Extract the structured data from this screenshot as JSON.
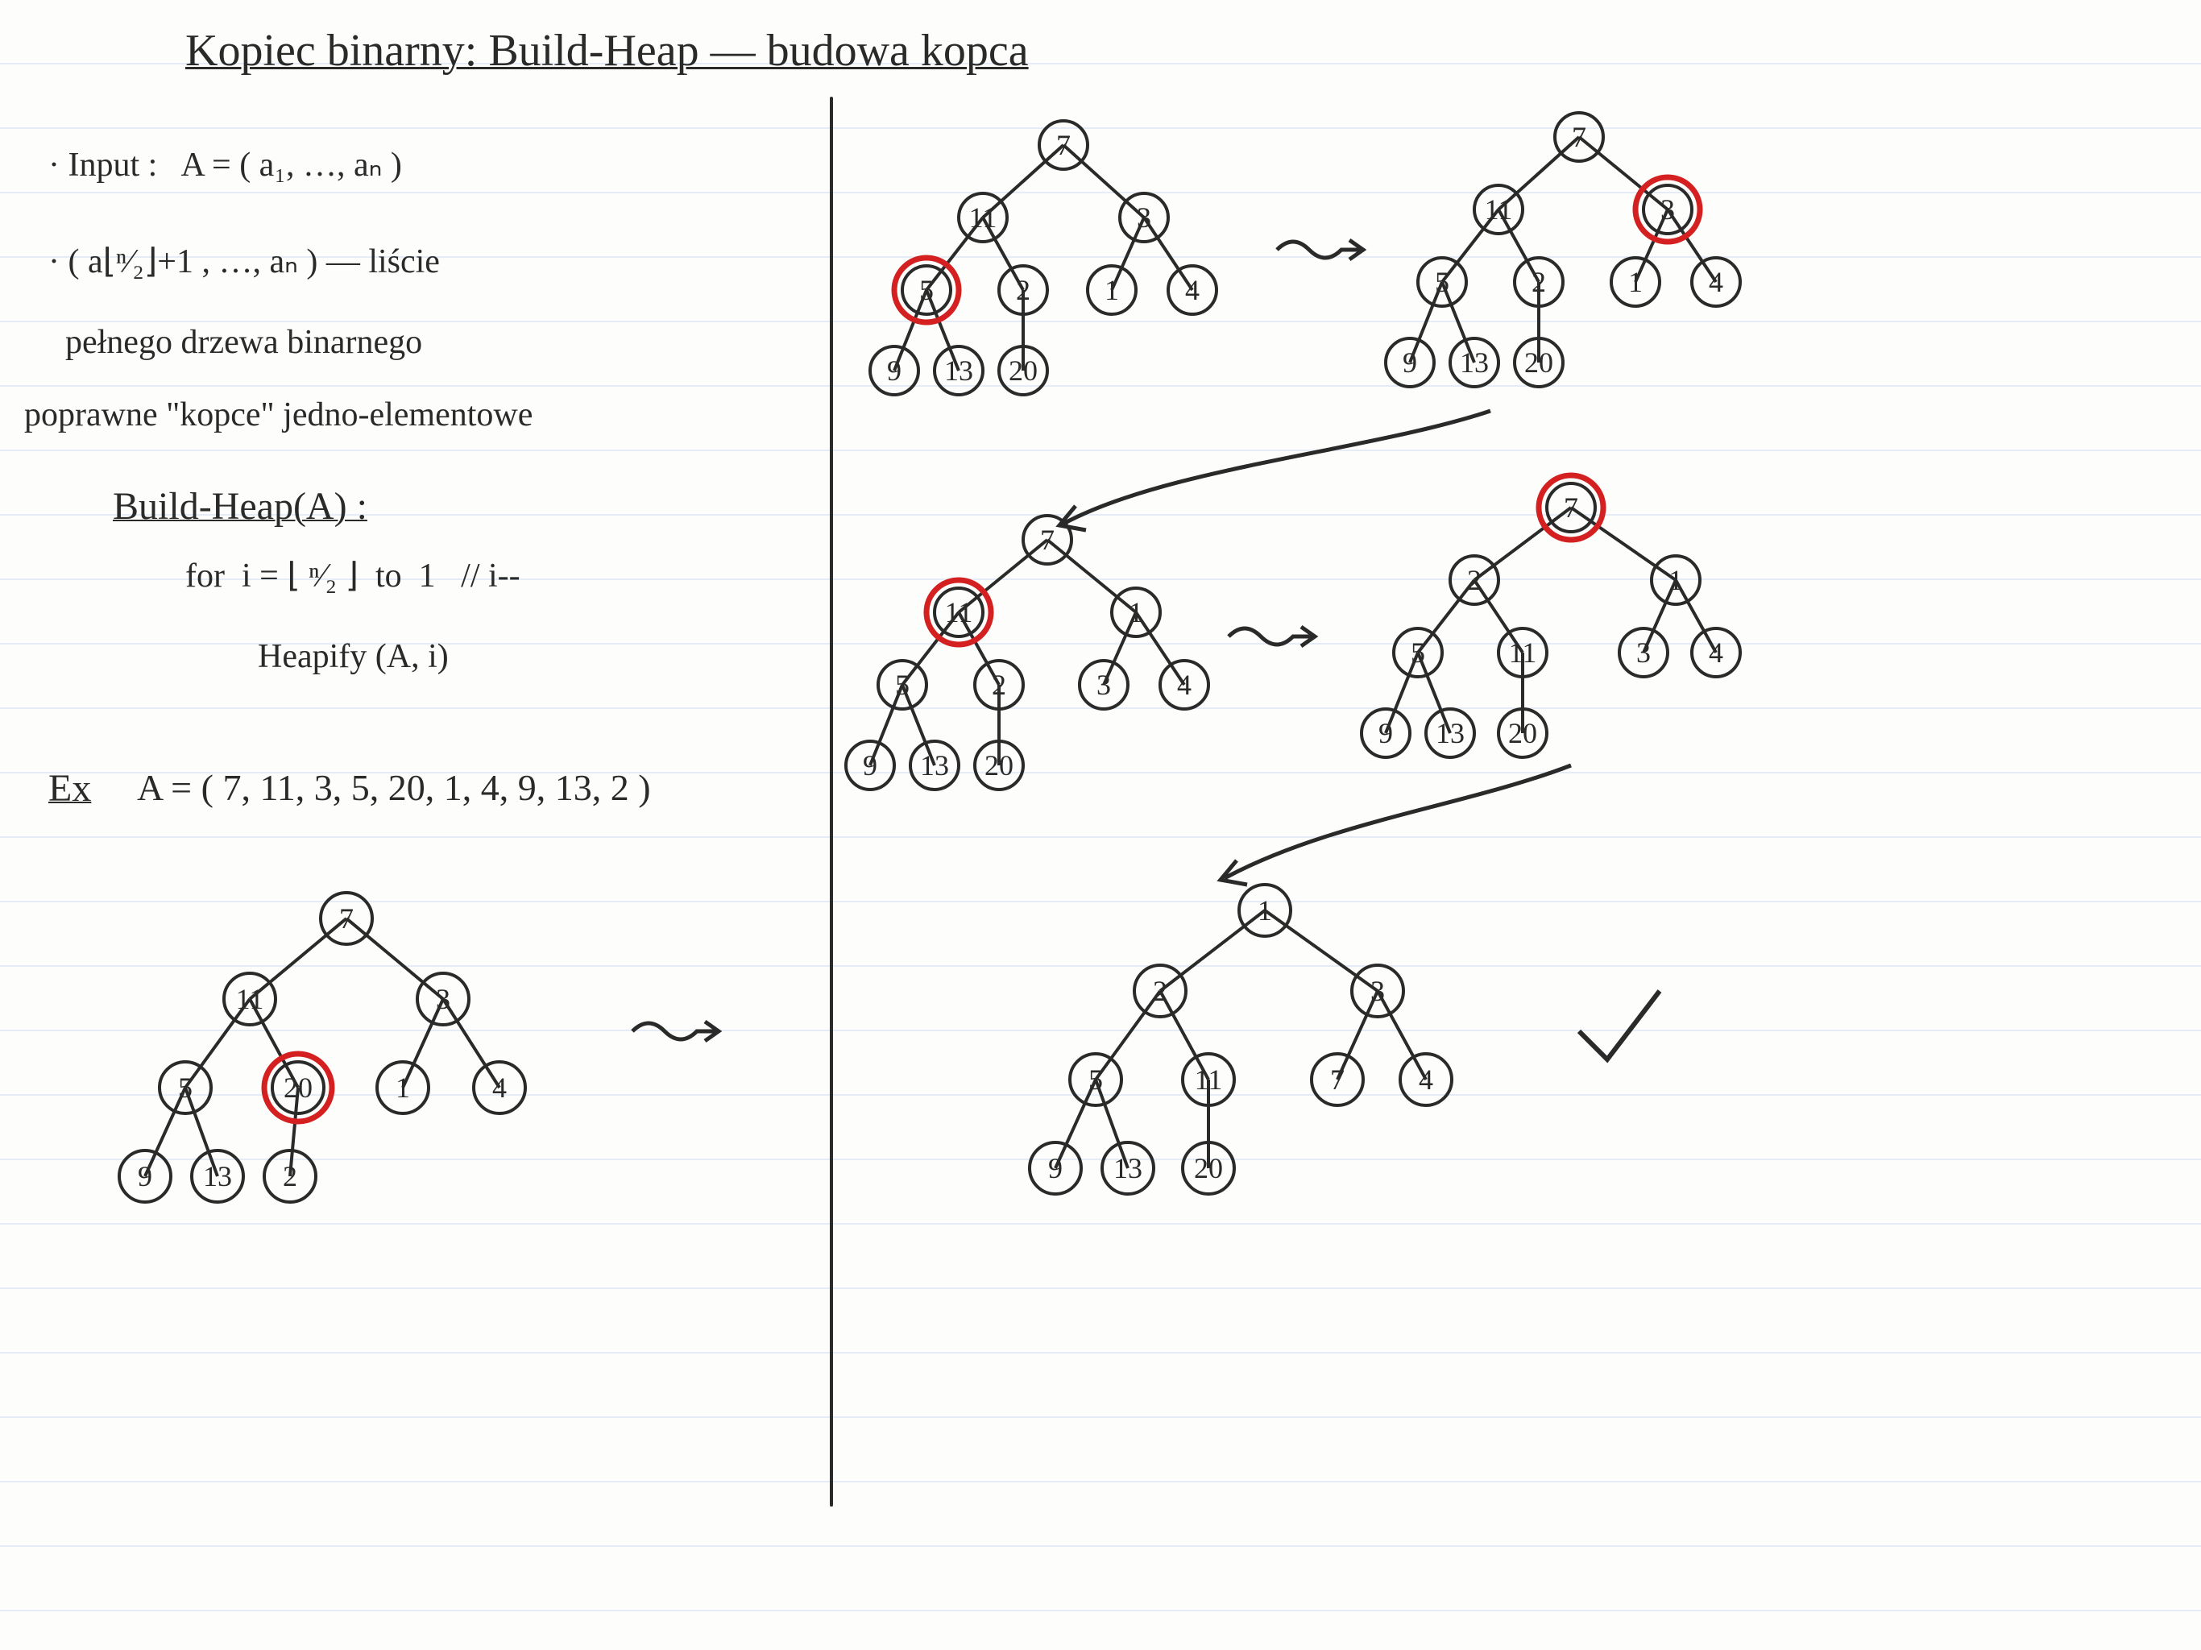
{
  "title": "Kopiec binarny: Build-Heap — budowa kopca",
  "notes": {
    "input_label": "· Input :   A = ( a₁, …, aₙ )",
    "leaves1": "· ( a⌊ⁿ⁄₂⌋+1 , …, aₙ ) — liście",
    "leaves2": "  pełnego drzewa binarnego",
    "leaves3": "poprawne \"kopce\" jedno-elementowe",
    "algo_title": "Build-Heap(A) :",
    "algo_line1": "for  i = ⌊ ⁿ⁄₂ ⌋  to  1   // i--",
    "algo_line2": "Heapify (A, i)",
    "ex_label": "Ex",
    "ex_array": "A = ( 7, 11, 3, 5, 20, 1, 4, 9, 13, 2 )"
  },
  "trees": {
    "t0": {
      "highlight": "20",
      "nodes": [
        "7",
        "11",
        "3",
        "5",
        "20",
        "1",
        "4",
        "9",
        "13",
        "2"
      ]
    },
    "t1": {
      "highlight": "5",
      "nodes": [
        "7",
        "11",
        "3",
        "5",
        "2",
        "1",
        "4",
        "9",
        "13",
        "20"
      ]
    },
    "t2": {
      "highlight": "3",
      "nodes": [
        "7",
        "11",
        "3",
        "5",
        "2",
        "1",
        "4",
        "9",
        "13",
        "20"
      ]
    },
    "t3": {
      "highlight": "11",
      "nodes": [
        "7",
        "11",
        "1",
        "5",
        "2",
        "3",
        "4",
        "9",
        "13",
        "20"
      ]
    },
    "t4": {
      "highlight": "7",
      "nodes": [
        "7",
        "2",
        "1",
        "5",
        "11",
        "3",
        "4",
        "9",
        "13",
        "20"
      ]
    },
    "t5": {
      "highlight": null,
      "nodes": [
        "1",
        "2",
        "3",
        "5",
        "11",
        "7",
        "4",
        "9",
        "13",
        "20"
      ]
    }
  },
  "arrows": {
    "squig": "~>",
    "check": "✓"
  }
}
